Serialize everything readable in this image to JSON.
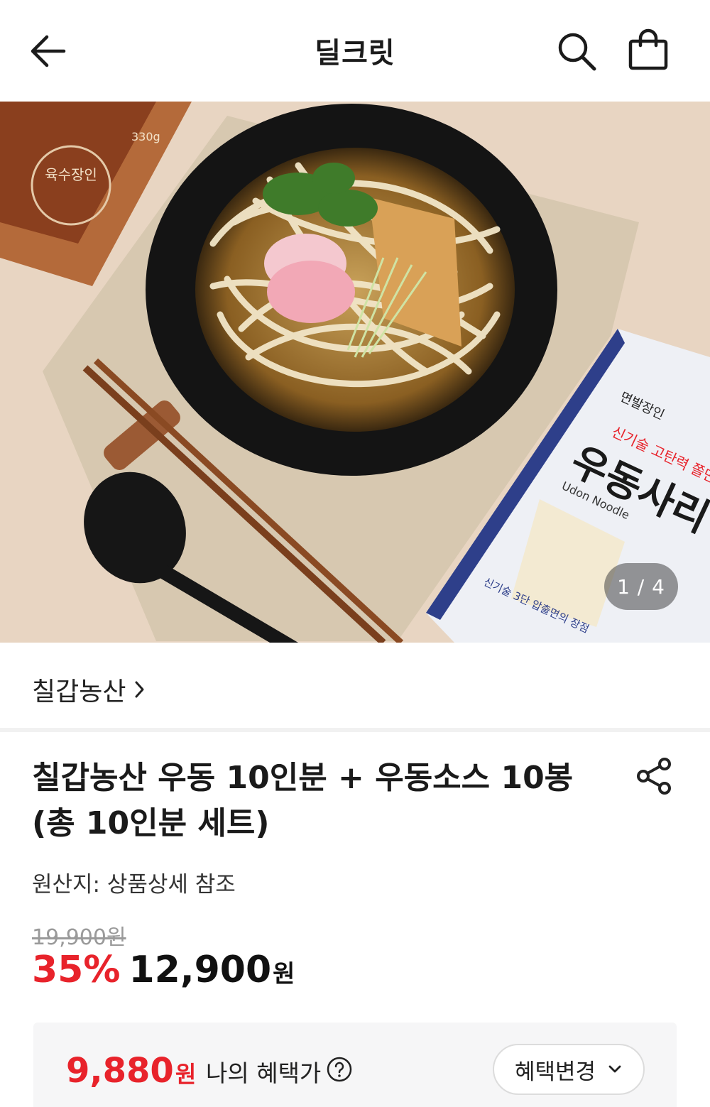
{
  "header": {
    "title": "딜크릿",
    "back_icon": "arrow-left-icon",
    "search_icon": "search-icon",
    "cart_icon": "shopping-bag-icon"
  },
  "gallery": {
    "counter": "1 / 4",
    "package_texts": {
      "brand_label": "면발장인",
      "slogan": "신기술 고탄력 쫄면",
      "product_name": "우동사리",
      "english_name": "Udon Noodle",
      "feature": "신기술 3단 압출면의 장점",
      "sauce_weight": "330g",
      "sauce_seal": "육수장인"
    }
  },
  "brand": {
    "name": "칠갑농산"
  },
  "product": {
    "title": "칠갑농산 우동 10인분 + 우동소스 10봉 (총 10인분 세트)",
    "origin": "원산지: 상품상세 참조",
    "original_price": "19,900원",
    "discount": "35%",
    "price": "12,900",
    "price_unit": "원"
  },
  "benefit": {
    "price": "9,880",
    "price_unit": "원",
    "label": "나의 혜택가",
    "button_label": "혜택변경"
  },
  "colors": {
    "accent_red": "#e8232b",
    "text_dark": "#1a1a1a",
    "muted": "#9a9a9a"
  }
}
